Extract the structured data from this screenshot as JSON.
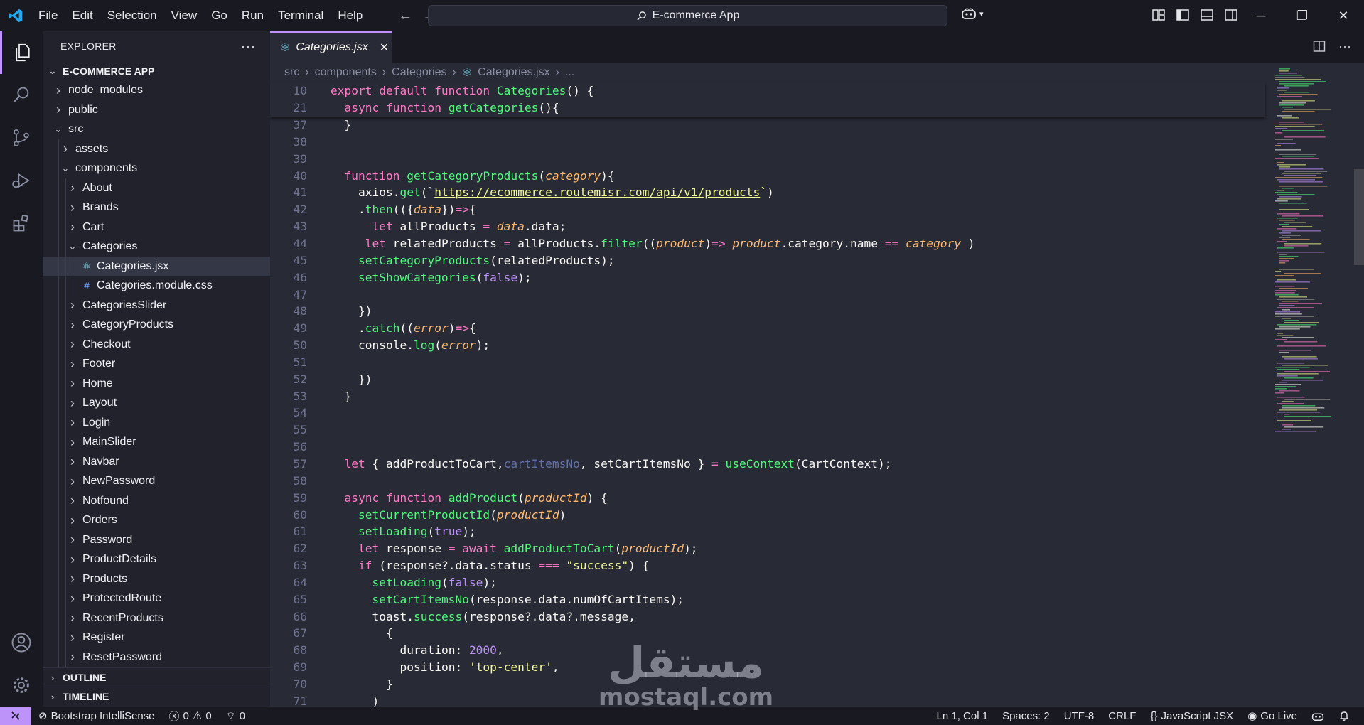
{
  "titlebar": {
    "menus": [
      "File",
      "Edit",
      "Selection",
      "View",
      "Go",
      "Run",
      "Terminal",
      "Help"
    ],
    "search_text": "E-commerce App"
  },
  "explorer": {
    "title": "EXPLORER",
    "root": "E-COMMERCE APP",
    "tree": [
      {
        "label": "node_modules",
        "depth": 0,
        "type": "folder",
        "open": false
      },
      {
        "label": "public",
        "depth": 0,
        "type": "folder",
        "open": false
      },
      {
        "label": "src",
        "depth": 0,
        "type": "folder",
        "open": true
      },
      {
        "label": "assets",
        "depth": 1,
        "type": "folder",
        "open": false
      },
      {
        "label": "components",
        "depth": 1,
        "type": "folder",
        "open": true
      },
      {
        "label": "About",
        "depth": 2,
        "type": "folder",
        "open": false
      },
      {
        "label": "Brands",
        "depth": 2,
        "type": "folder",
        "open": false
      },
      {
        "label": "Cart",
        "depth": 2,
        "type": "folder",
        "open": false
      },
      {
        "label": "Categories",
        "depth": 2,
        "type": "folder",
        "open": true
      },
      {
        "label": "Categories.jsx",
        "depth": 3,
        "type": "jsx",
        "selected": true
      },
      {
        "label": "Categories.module.css",
        "depth": 3,
        "type": "css"
      },
      {
        "label": "CategoriesSlider",
        "depth": 2,
        "type": "folder",
        "open": false
      },
      {
        "label": "CategoryProducts",
        "depth": 2,
        "type": "folder",
        "open": false
      },
      {
        "label": "Checkout",
        "depth": 2,
        "type": "folder",
        "open": false
      },
      {
        "label": "Footer",
        "depth": 2,
        "type": "folder",
        "open": false
      },
      {
        "label": "Home",
        "depth": 2,
        "type": "folder",
        "open": false
      },
      {
        "label": "Layout",
        "depth": 2,
        "type": "folder",
        "open": false
      },
      {
        "label": "Login",
        "depth": 2,
        "type": "folder",
        "open": false
      },
      {
        "label": "MainSlider",
        "depth": 2,
        "type": "folder",
        "open": false
      },
      {
        "label": "Navbar",
        "depth": 2,
        "type": "folder",
        "open": false
      },
      {
        "label": "NewPassword",
        "depth": 2,
        "type": "folder",
        "open": false
      },
      {
        "label": "Notfound",
        "depth": 2,
        "type": "folder",
        "open": false
      },
      {
        "label": "Orders",
        "depth": 2,
        "type": "folder",
        "open": false
      },
      {
        "label": "Password",
        "depth": 2,
        "type": "folder",
        "open": false
      },
      {
        "label": "ProductDetails",
        "depth": 2,
        "type": "folder",
        "open": false
      },
      {
        "label": "Products",
        "depth": 2,
        "type": "folder",
        "open": false
      },
      {
        "label": "ProtectedRoute",
        "depth": 2,
        "type": "folder",
        "open": false
      },
      {
        "label": "RecentProducts",
        "depth": 2,
        "type": "folder",
        "open": false
      },
      {
        "label": "Register",
        "depth": 2,
        "type": "folder",
        "open": false
      },
      {
        "label": "ResetPassword",
        "depth": 2,
        "type": "folder",
        "open": false
      }
    ],
    "outline": "OUTLINE",
    "timeline": "TIMELINE"
  },
  "editor": {
    "tab_label": "Categories.jsx",
    "breadcrumb": [
      "src",
      "components",
      "Categories",
      "Categories.jsx",
      "..."
    ],
    "sticky_lines": [
      {
        "n": "10",
        "indent": 0,
        "tokens": [
          [
            "kw",
            "export default function "
          ],
          [
            "fn",
            "Categories"
          ],
          [
            "plain",
            "() {"
          ]
        ]
      },
      {
        "n": "21",
        "indent": 1,
        "tokens": [
          [
            "kw",
            "async function "
          ],
          [
            "fn",
            "getCategories"
          ],
          [
            "plain",
            "(){"
          ]
        ]
      }
    ],
    "lines": [
      {
        "n": "37",
        "indent": 1,
        "tokens": [
          [
            "plain",
            "}"
          ]
        ]
      },
      {
        "n": "38",
        "indent": 0,
        "tokens": []
      },
      {
        "n": "39",
        "indent": 0,
        "tokens": []
      },
      {
        "n": "40",
        "indent": 1,
        "tokens": [
          [
            "kw",
            "function "
          ],
          [
            "fn",
            "getCategoryProducts"
          ],
          [
            "plain",
            "("
          ],
          [
            "prm",
            "category"
          ],
          [
            "plain",
            "){"
          ]
        ]
      },
      {
        "n": "41",
        "indent": 2,
        "tokens": [
          [
            "plain",
            "axios."
          ],
          [
            "fn",
            "get"
          ],
          [
            "plain",
            "(`"
          ],
          [
            "url",
            "https://ecommerce.routemisr.com/api/v1/products"
          ],
          [
            "str",
            "`"
          ],
          [
            "plain",
            ")"
          ]
        ]
      },
      {
        "n": "42",
        "indent": 2,
        "tokens": [
          [
            "plain",
            "."
          ],
          [
            "fn",
            "then"
          ],
          [
            "plain",
            "(({"
          ],
          [
            "prm",
            "data"
          ],
          [
            "plain",
            "})"
          ],
          [
            "kw",
            "=>"
          ],
          [
            "plain",
            "{"
          ]
        ]
      },
      {
        "n": "43",
        "indent": 3,
        "tokens": [
          [
            "kw",
            "let "
          ],
          [
            "plain",
            "allProducts "
          ],
          [
            "kw",
            "= "
          ],
          [
            "prm",
            "data"
          ],
          [
            "plain",
            ".data;"
          ]
        ]
      },
      {
        "n": "44",
        "indent": 2,
        "extra": " ",
        "tokens": [
          [
            "kw",
            "let "
          ],
          [
            "plain",
            "relatedProducts "
          ],
          [
            "kw",
            "= "
          ],
          [
            "plain",
            "allProducts."
          ],
          [
            "fn",
            "filter"
          ],
          [
            "plain",
            "(("
          ],
          [
            "prm",
            "product"
          ],
          [
            "plain",
            ")"
          ],
          [
            "kw",
            "=> "
          ],
          [
            "prm",
            "product"
          ],
          [
            "plain",
            ".category.name "
          ],
          [
            "kw",
            "== "
          ],
          [
            "prm",
            "category"
          ],
          [
            "plain",
            " )"
          ]
        ]
      },
      {
        "n": "45",
        "indent": 2,
        "tokens": [
          [
            "fn",
            "setCategoryProducts"
          ],
          [
            "plain",
            "(relatedProducts);"
          ]
        ]
      },
      {
        "n": "46",
        "indent": 2,
        "tokens": [
          [
            "fn",
            "setShowCategories"
          ],
          [
            "plain",
            "("
          ],
          [
            "num",
            "false"
          ],
          [
            "plain",
            ");"
          ]
        ]
      },
      {
        "n": "47",
        "indent": 0,
        "tokens": []
      },
      {
        "n": "48",
        "indent": 2,
        "tokens": [
          [
            "plain",
            "})"
          ]
        ]
      },
      {
        "n": "49",
        "indent": 2,
        "tokens": [
          [
            "plain",
            "."
          ],
          [
            "fn",
            "catch"
          ],
          [
            "plain",
            "(("
          ],
          [
            "prm",
            "error"
          ],
          [
            "plain",
            ")"
          ],
          [
            "kw",
            "=>"
          ],
          [
            "plain",
            "{"
          ]
        ]
      },
      {
        "n": "50",
        "indent": 2,
        "tokens": [
          [
            "plain",
            "console."
          ],
          [
            "fn",
            "log"
          ],
          [
            "plain",
            "("
          ],
          [
            "prm",
            "error"
          ],
          [
            "plain",
            ");"
          ]
        ]
      },
      {
        "n": "51",
        "indent": 0,
        "tokens": []
      },
      {
        "n": "52",
        "indent": 2,
        "tokens": [
          [
            "plain",
            "})"
          ]
        ]
      },
      {
        "n": "53",
        "indent": 1,
        "tokens": [
          [
            "plain",
            "}"
          ]
        ]
      },
      {
        "n": "54",
        "indent": 0,
        "tokens": []
      },
      {
        "n": "55",
        "indent": 0,
        "tokens": []
      },
      {
        "n": "56",
        "indent": 0,
        "tokens": []
      },
      {
        "n": "57",
        "indent": 1,
        "tokens": [
          [
            "kw",
            "let "
          ],
          [
            "plain",
            "{ addProductToCart,"
          ],
          [
            "cmt",
            "cartItemsNo"
          ],
          [
            "plain",
            ", setCartItemsNo } "
          ],
          [
            "kw",
            "= "
          ],
          [
            "fn",
            "useContext"
          ],
          [
            "plain",
            "(CartContext);"
          ]
        ]
      },
      {
        "n": "58",
        "indent": 0,
        "tokens": []
      },
      {
        "n": "59",
        "indent": 1,
        "tokens": [
          [
            "kw",
            "async function "
          ],
          [
            "fn",
            "addProduct"
          ],
          [
            "plain",
            "("
          ],
          [
            "prm",
            "productId"
          ],
          [
            "plain",
            ") {"
          ]
        ]
      },
      {
        "n": "60",
        "indent": 2,
        "tokens": [
          [
            "fn",
            "setCurrentProductId"
          ],
          [
            "plain",
            "("
          ],
          [
            "prm",
            "productId"
          ],
          [
            "plain",
            ")"
          ]
        ]
      },
      {
        "n": "61",
        "indent": 2,
        "tokens": [
          [
            "fn",
            "setLoading"
          ],
          [
            "plain",
            "("
          ],
          [
            "num",
            "true"
          ],
          [
            "plain",
            ");"
          ]
        ]
      },
      {
        "n": "62",
        "indent": 2,
        "tokens": [
          [
            "kw",
            "let "
          ],
          [
            "plain",
            "response "
          ],
          [
            "kw",
            "= await "
          ],
          [
            "fn",
            "addProductToCart"
          ],
          [
            "plain",
            "("
          ],
          [
            "prm",
            "productId"
          ],
          [
            "plain",
            ");"
          ]
        ]
      },
      {
        "n": "63",
        "indent": 2,
        "tokens": [
          [
            "kw",
            "if "
          ],
          [
            "plain",
            "(response?.data.status "
          ],
          [
            "kw",
            "=== "
          ],
          [
            "str",
            "\"success\""
          ],
          [
            "plain",
            ") {"
          ]
        ]
      },
      {
        "n": "64",
        "indent": 3,
        "tokens": [
          [
            "fn",
            "setLoading"
          ],
          [
            "plain",
            "("
          ],
          [
            "num",
            "false"
          ],
          [
            "plain",
            ");"
          ]
        ]
      },
      {
        "n": "65",
        "indent": 3,
        "tokens": [
          [
            "fn",
            "setCartItemsNo"
          ],
          [
            "plain",
            "(response.data.numOfCartItems);"
          ]
        ]
      },
      {
        "n": "66",
        "indent": 3,
        "tokens": [
          [
            "plain",
            "toast."
          ],
          [
            "fn",
            "success"
          ],
          [
            "plain",
            "(response?.data?.message,"
          ]
        ]
      },
      {
        "n": "67",
        "indent": 4,
        "tokens": [
          [
            "plain",
            "{"
          ]
        ]
      },
      {
        "n": "68",
        "indent": 5,
        "tokens": [
          [
            "plain",
            "duration: "
          ],
          [
            "num",
            "2000"
          ],
          [
            "plain",
            ","
          ]
        ]
      },
      {
        "n": "69",
        "indent": 5,
        "tokens": [
          [
            "plain",
            "position: "
          ],
          [
            "str",
            "'top-center'"
          ],
          [
            "plain",
            ","
          ]
        ]
      },
      {
        "n": "70",
        "indent": 4,
        "tokens": [
          [
            "plain",
            "}"
          ]
        ]
      },
      {
        "n": "71",
        "indent": 3,
        "tokens": [
          [
            "plain",
            ")"
          ]
        ]
      }
    ]
  },
  "watermark": {
    "arabic": "مستقل",
    "latin": "mostaql.com"
  },
  "statusbar": {
    "bootstrap": "Bootstrap IntelliSense",
    "errors": "0",
    "warnings": "0",
    "ports": "0",
    "cursor": "Ln 1, Col 1",
    "spaces": "Spaces: 2",
    "encoding": "UTF-8",
    "eol": "CRLF",
    "language": "JavaScript JSX",
    "golive": "Go Live"
  },
  "colors": {
    "accent": "#bd93f9",
    "keyword": "#ff79c6",
    "function": "#50fa7b",
    "string": "#f1fa8c",
    "param": "#ffb86c"
  }
}
